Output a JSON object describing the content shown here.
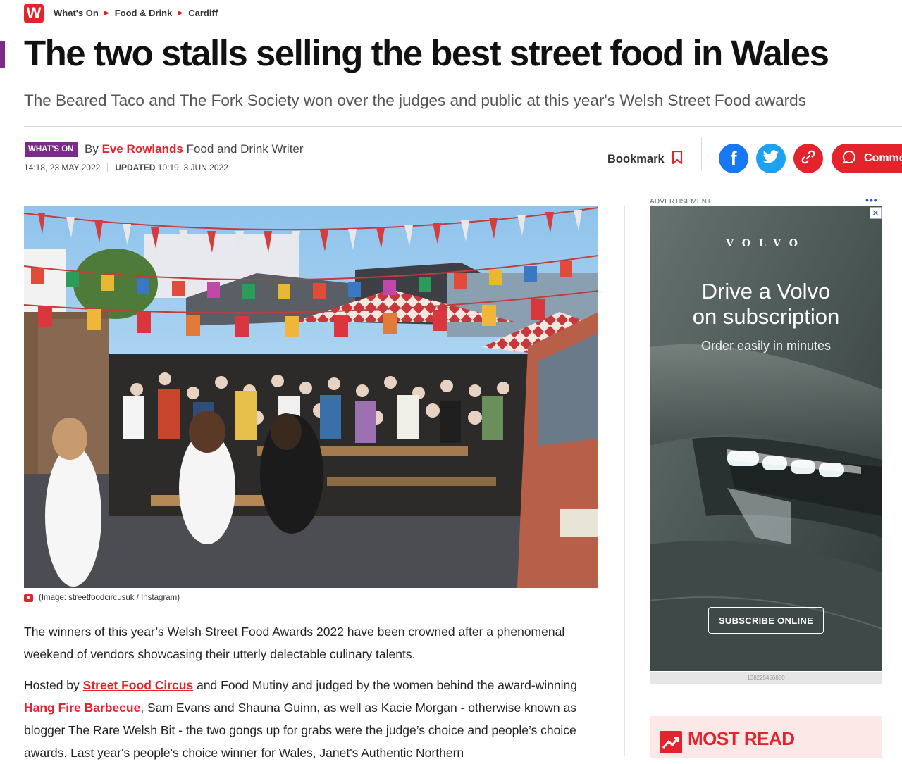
{
  "header": {
    "logo_letter": "W",
    "breadcrumbs": [
      "What's On",
      "Food & Drink",
      "Cardiff"
    ]
  },
  "article": {
    "headline": "The two stalls selling the best street food in Wales",
    "subheadline": "The Beared Taco and The Fork Society won over the judges and public at this year's Welsh Street Food awards",
    "section_badge": "WHAT'S ON",
    "byline_prefix": "By",
    "author": "Eve Rowlands",
    "author_role": "Food and Drink Writer",
    "published": "14:18, 23 MAY 2022",
    "updated_label": "UPDATED",
    "updated": "10:19, 3 JUN 2022",
    "image_caption": "(Image: streetfoodcircusuk / Instagram)",
    "paragraph1": "The winners of this year’s Welsh Street Food Awards 2022 have been crowned after a phenomenal weekend of vendors showcasing their utterly delectable culinary talents.",
    "p2": {
      "t1": "Hosted by ",
      "link1": "Street Food Circus",
      "t2": " and Food Mutiny and judged by the women behind the award-winning ",
      "link2": "Hang Fire Barbecue",
      "t3": ", Sam Evans and Shauna Guinn, as well as Kacie Morgan - otherwise known as blogger The Rare Welsh Bit - the two gongs up for grabs were the judge’s choice and people’s choice awards. Last year's people's choice winner for Wales, Janet's Authentic Northern"
    }
  },
  "actions": {
    "bookmark_label": "Bookmark",
    "comments_label": "Comme",
    "facebook_glyph": "f"
  },
  "advert": {
    "label": "ADVERTISEMENT",
    "dots": "•••",
    "close": "✕",
    "brand": "VOLVO",
    "headline_line1": "Drive a Volvo",
    "headline_line2": "on subscription",
    "subline": "Order easily in minutes",
    "button": "SUBSCRIBE ONLINE",
    "id_text": "138225456850"
  },
  "sidebar": {
    "most_read_title": "MOST READ"
  },
  "colors": {
    "brand_red": "#e4232d",
    "section_purple": "#7a2b87",
    "facebook": "#1877f2",
    "twitter": "#1da1f2"
  }
}
